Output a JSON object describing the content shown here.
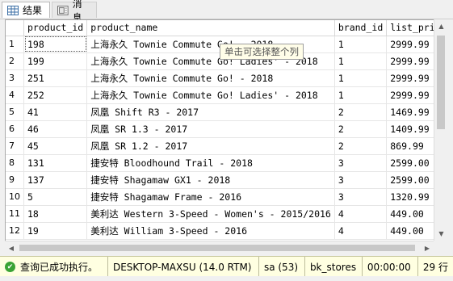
{
  "tabs": [
    {
      "label": "结果",
      "icon": "grid-icon",
      "active": true
    },
    {
      "label": "消息",
      "icon": "message-icon",
      "active": false
    }
  ],
  "columns": [
    "",
    "product_id",
    "product_name",
    "brand_id",
    "list_price"
  ],
  "rows": [
    {
      "n": "1",
      "product_id": "198",
      "product_name": "上海永久 Townie Commute Go! - 2018",
      "brand_id": "1",
      "list_price": "2999.99"
    },
    {
      "n": "2",
      "product_id": "199",
      "product_name": "上海永久 Townie Commute Go! Ladies' - 2018",
      "brand_id": "1",
      "list_price": "2999.99"
    },
    {
      "n": "3",
      "product_id": "251",
      "product_name": "上海永久 Townie Commute Go! - 2018",
      "brand_id": "1",
      "list_price": "2999.99"
    },
    {
      "n": "4",
      "product_id": "252",
      "product_name": "上海永久 Townie Commute Go! Ladies' - 2018",
      "brand_id": "1",
      "list_price": "2999.99"
    },
    {
      "n": "5",
      "product_id": "41",
      "product_name": "凤凰 Shift R3 - 2017",
      "brand_id": "2",
      "list_price": "1469.99"
    },
    {
      "n": "6",
      "product_id": "46",
      "product_name": "凤凰 SR 1.3 - 2017",
      "brand_id": "2",
      "list_price": "1409.99"
    },
    {
      "n": "7",
      "product_id": "45",
      "product_name": "凤凰 SR 1.2 - 2017",
      "brand_id": "2",
      "list_price": "869.99"
    },
    {
      "n": "8",
      "product_id": "131",
      "product_name": "捷安特 Bloodhound Trail - 2018",
      "brand_id": "3",
      "list_price": "2599.00"
    },
    {
      "n": "9",
      "product_id": "137",
      "product_name": "捷安特 Shagamaw GX1 - 2018",
      "brand_id": "3",
      "list_price": "2599.00"
    },
    {
      "n": "10",
      "product_id": "5",
      "product_name": "捷安特 Shagamaw Frame - 2016",
      "brand_id": "3",
      "list_price": "1320.99"
    },
    {
      "n": "11",
      "product_id": "18",
      "product_name": "美利达 Western 3-Speed - Women's - 2015/2016",
      "brand_id": "4",
      "list_price": "449.00"
    },
    {
      "n": "12",
      "product_id": "19",
      "product_name": "美利达 William 3-Speed - 2016",
      "brand_id": "4",
      "list_price": "449.00"
    }
  ],
  "tooltip": "单击可选择整个列",
  "status": {
    "message": "查询已成功执行。",
    "server": "DESKTOP-MAXSU (14.0 RTM)",
    "user": "sa (53)",
    "database": "bk_stores",
    "elapsed": "00:00:00",
    "row_count": "29 行"
  },
  "colors": {
    "status_bg": "#ffffe1",
    "ok_green": "#3aa335"
  }
}
